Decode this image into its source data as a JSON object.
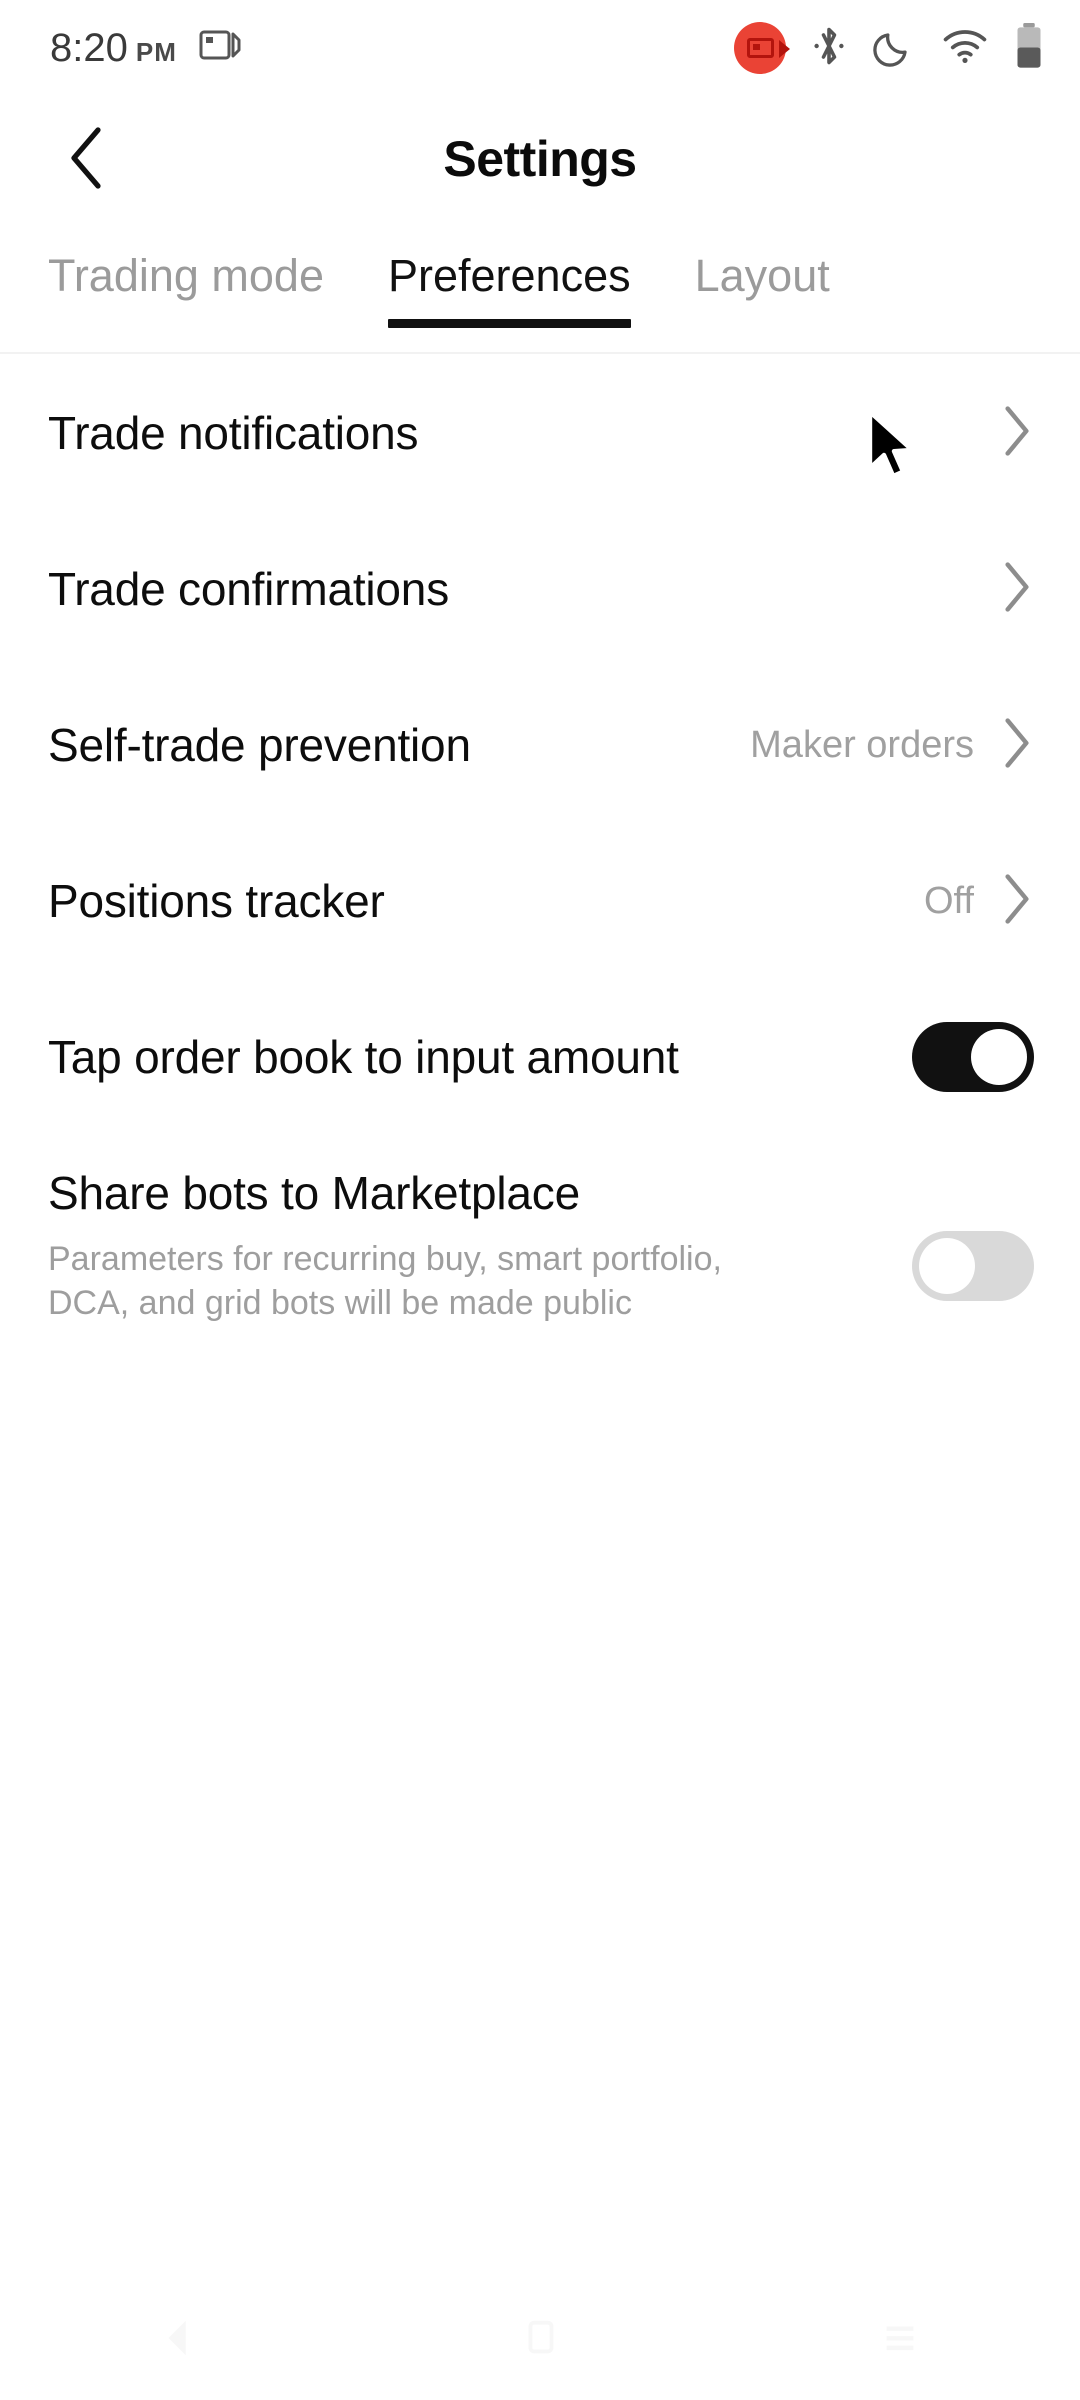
{
  "statusbar": {
    "time": "8:20",
    "ampm": "PM",
    "icons": {
      "screen_cast": "screen-cast-icon",
      "screen_record": "screen-record-icon",
      "bluetooth": "bluetooth-icon",
      "dnd": "moon-dnd-icon",
      "wifi": "wifi-icon",
      "battery": "battery-icon"
    }
  },
  "header": {
    "title": "Settings",
    "back_icon": "chevron-left-icon"
  },
  "tabs": [
    {
      "label": "Trading mode",
      "active": false
    },
    {
      "label": "Preferences",
      "active": true
    },
    {
      "label": "Layout",
      "active": false
    }
  ],
  "rows": [
    {
      "label": "Trade notifications",
      "value": "",
      "control": "chevron"
    },
    {
      "label": "Trade confirmations",
      "value": "",
      "control": "chevron"
    },
    {
      "label": "Self-trade prevention",
      "value": "Maker orders",
      "control": "chevron"
    },
    {
      "label": "Positions tracker",
      "value": "Off",
      "control": "chevron"
    },
    {
      "label": "Tap order book to input amount",
      "value": "",
      "control": "toggle",
      "toggle_state": "on"
    },
    {
      "label": "Share bots to Marketplace",
      "subtitle": "Parameters for recurring buy, smart portfolio, DCA, and grid bots will be made public",
      "value": "",
      "control": "toggle",
      "toggle_state": "off"
    }
  ],
  "navbar": [
    {
      "icon": "back-triangle-icon"
    },
    {
      "icon": "home-square-icon"
    },
    {
      "icon": "recents-lines-icon"
    }
  ],
  "colors": {
    "accent_record": "#ea4335",
    "toggle_on": "#111111",
    "toggle_off": "#d9d9d9",
    "text_primary": "#0d0d0d",
    "text_muted": "#9e9e9e"
  },
  "cursor": {
    "name": "mouse-pointer"
  }
}
